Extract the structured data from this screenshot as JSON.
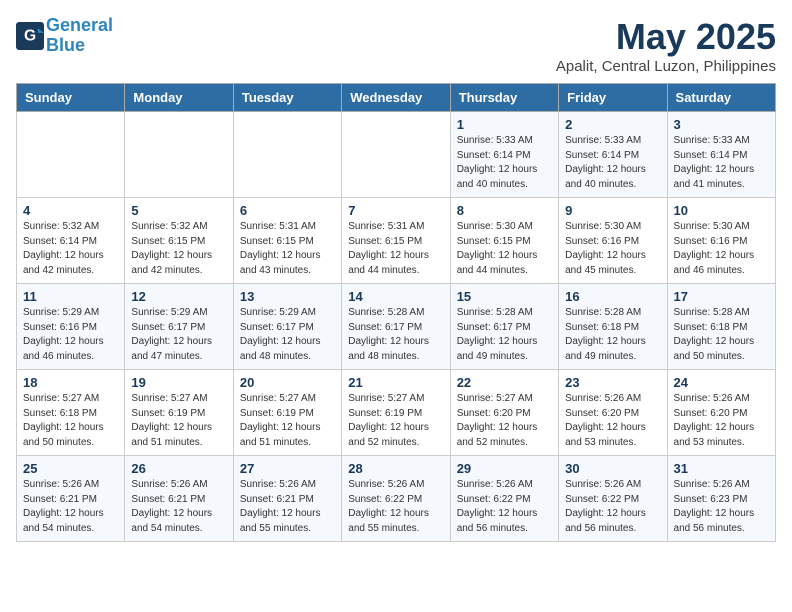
{
  "header": {
    "logo_line1": "General",
    "logo_line2": "Blue",
    "month": "May 2025",
    "location": "Apalit, Central Luzon, Philippines"
  },
  "days_of_week": [
    "Sunday",
    "Monday",
    "Tuesday",
    "Wednesday",
    "Thursday",
    "Friday",
    "Saturday"
  ],
  "weeks": [
    [
      {
        "day": "",
        "info": ""
      },
      {
        "day": "",
        "info": ""
      },
      {
        "day": "",
        "info": ""
      },
      {
        "day": "",
        "info": ""
      },
      {
        "day": "1",
        "info": "Sunrise: 5:33 AM\nSunset: 6:14 PM\nDaylight: 12 hours\nand 40 minutes."
      },
      {
        "day": "2",
        "info": "Sunrise: 5:33 AM\nSunset: 6:14 PM\nDaylight: 12 hours\nand 40 minutes."
      },
      {
        "day": "3",
        "info": "Sunrise: 5:33 AM\nSunset: 6:14 PM\nDaylight: 12 hours\nand 41 minutes."
      }
    ],
    [
      {
        "day": "4",
        "info": "Sunrise: 5:32 AM\nSunset: 6:14 PM\nDaylight: 12 hours\nand 42 minutes."
      },
      {
        "day": "5",
        "info": "Sunrise: 5:32 AM\nSunset: 6:15 PM\nDaylight: 12 hours\nand 42 minutes."
      },
      {
        "day": "6",
        "info": "Sunrise: 5:31 AM\nSunset: 6:15 PM\nDaylight: 12 hours\nand 43 minutes."
      },
      {
        "day": "7",
        "info": "Sunrise: 5:31 AM\nSunset: 6:15 PM\nDaylight: 12 hours\nand 44 minutes."
      },
      {
        "day": "8",
        "info": "Sunrise: 5:30 AM\nSunset: 6:15 PM\nDaylight: 12 hours\nand 44 minutes."
      },
      {
        "day": "9",
        "info": "Sunrise: 5:30 AM\nSunset: 6:16 PM\nDaylight: 12 hours\nand 45 minutes."
      },
      {
        "day": "10",
        "info": "Sunrise: 5:30 AM\nSunset: 6:16 PM\nDaylight: 12 hours\nand 46 minutes."
      }
    ],
    [
      {
        "day": "11",
        "info": "Sunrise: 5:29 AM\nSunset: 6:16 PM\nDaylight: 12 hours\nand 46 minutes."
      },
      {
        "day": "12",
        "info": "Sunrise: 5:29 AM\nSunset: 6:17 PM\nDaylight: 12 hours\nand 47 minutes."
      },
      {
        "day": "13",
        "info": "Sunrise: 5:29 AM\nSunset: 6:17 PM\nDaylight: 12 hours\nand 48 minutes."
      },
      {
        "day": "14",
        "info": "Sunrise: 5:28 AM\nSunset: 6:17 PM\nDaylight: 12 hours\nand 48 minutes."
      },
      {
        "day": "15",
        "info": "Sunrise: 5:28 AM\nSunset: 6:17 PM\nDaylight: 12 hours\nand 49 minutes."
      },
      {
        "day": "16",
        "info": "Sunrise: 5:28 AM\nSunset: 6:18 PM\nDaylight: 12 hours\nand 49 minutes."
      },
      {
        "day": "17",
        "info": "Sunrise: 5:28 AM\nSunset: 6:18 PM\nDaylight: 12 hours\nand 50 minutes."
      }
    ],
    [
      {
        "day": "18",
        "info": "Sunrise: 5:27 AM\nSunset: 6:18 PM\nDaylight: 12 hours\nand 50 minutes."
      },
      {
        "day": "19",
        "info": "Sunrise: 5:27 AM\nSunset: 6:19 PM\nDaylight: 12 hours\nand 51 minutes."
      },
      {
        "day": "20",
        "info": "Sunrise: 5:27 AM\nSunset: 6:19 PM\nDaylight: 12 hours\nand 51 minutes."
      },
      {
        "day": "21",
        "info": "Sunrise: 5:27 AM\nSunset: 6:19 PM\nDaylight: 12 hours\nand 52 minutes."
      },
      {
        "day": "22",
        "info": "Sunrise: 5:27 AM\nSunset: 6:20 PM\nDaylight: 12 hours\nand 52 minutes."
      },
      {
        "day": "23",
        "info": "Sunrise: 5:26 AM\nSunset: 6:20 PM\nDaylight: 12 hours\nand 53 minutes."
      },
      {
        "day": "24",
        "info": "Sunrise: 5:26 AM\nSunset: 6:20 PM\nDaylight: 12 hours\nand 53 minutes."
      }
    ],
    [
      {
        "day": "25",
        "info": "Sunrise: 5:26 AM\nSunset: 6:21 PM\nDaylight: 12 hours\nand 54 minutes."
      },
      {
        "day": "26",
        "info": "Sunrise: 5:26 AM\nSunset: 6:21 PM\nDaylight: 12 hours\nand 54 minutes."
      },
      {
        "day": "27",
        "info": "Sunrise: 5:26 AM\nSunset: 6:21 PM\nDaylight: 12 hours\nand 55 minutes."
      },
      {
        "day": "28",
        "info": "Sunrise: 5:26 AM\nSunset: 6:22 PM\nDaylight: 12 hours\nand 55 minutes."
      },
      {
        "day": "29",
        "info": "Sunrise: 5:26 AM\nSunset: 6:22 PM\nDaylight: 12 hours\nand 56 minutes."
      },
      {
        "day": "30",
        "info": "Sunrise: 5:26 AM\nSunset: 6:22 PM\nDaylight: 12 hours\nand 56 minutes."
      },
      {
        "day": "31",
        "info": "Sunrise: 5:26 AM\nSunset: 6:23 PM\nDaylight: 12 hours\nand 56 minutes."
      }
    ]
  ]
}
